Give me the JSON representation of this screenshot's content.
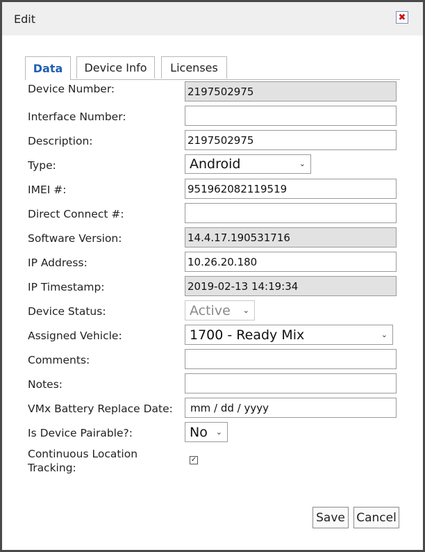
{
  "dialog": {
    "title": "Edit"
  },
  "tabs": [
    {
      "label": "Data"
    },
    {
      "label": "Device Info"
    },
    {
      "label": "Licenses"
    }
  ],
  "form": {
    "device_number": {
      "label": "Device Number:",
      "value": "2197502975"
    },
    "interface_number": {
      "label": "Interface Number:",
      "value": ""
    },
    "description": {
      "label": "Description:",
      "value": "2197502975"
    },
    "type": {
      "label": "Type:",
      "value": "Android"
    },
    "imei": {
      "label": "IMEI #:",
      "value": "951962082119519"
    },
    "direct_connect": {
      "label": "Direct Connect #:",
      "value": ""
    },
    "software_version": {
      "label": "Software Version:",
      "value": "14.4.17.190531716"
    },
    "ip_address": {
      "label": "IP Address:",
      "value": "10.26.20.180"
    },
    "ip_timestamp": {
      "label": "IP Timestamp:",
      "value": "2019-02-13 14:19:34"
    },
    "device_status": {
      "label": "Device Status:",
      "value": "Active"
    },
    "assigned_vehicle": {
      "label": "Assigned Vehicle:",
      "value": "1700 - Ready Mix"
    },
    "comments": {
      "label": "Comments:",
      "value": ""
    },
    "notes": {
      "label": "Notes:",
      "value": ""
    },
    "battery_date": {
      "label": "VMx Battery Replace Date:",
      "value": "mm / dd / yyyy"
    },
    "pairable": {
      "label": "Is Device Pairable?:",
      "value": "No"
    },
    "continuous_tracking": {
      "label_line1": "Continuous Location",
      "label_line2": "Tracking:",
      "checked": true
    }
  },
  "buttons": {
    "save": "Save",
    "cancel": "Cancel"
  },
  "icons": {
    "close": "close-icon",
    "chevron": "chevron-down-icon",
    "check": "check-icon"
  },
  "colors": {
    "active_tab": "#1f5fb0",
    "close_x": "#d01010",
    "readonly_bg": "#e2e2e2"
  }
}
